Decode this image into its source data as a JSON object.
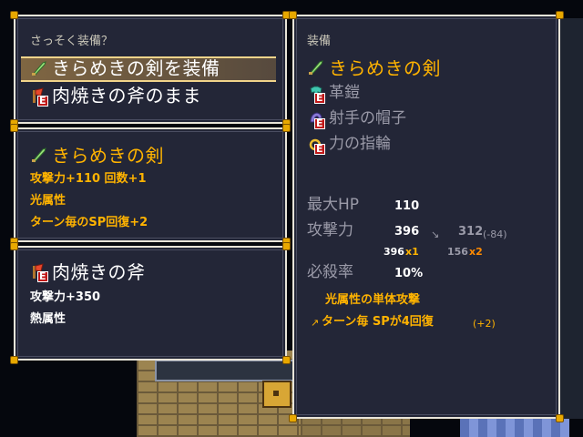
{
  "equip_menu": {
    "prompt": "さっそく装備？",
    "options": [
      {
        "label": "きらめきの剣を装備",
        "selected": true
      },
      {
        "label": "肉焼きの斧のまま",
        "selected": false
      }
    ]
  },
  "new_item": {
    "name": "きらめきの剣",
    "line1": "攻撃力+110 回数+1",
    "line2": "光属性",
    "line3": "ターン毎のSP回復+2"
  },
  "current_item": {
    "name": "肉焼きの斧",
    "line1": "攻撃力+350",
    "line2": "熱属性"
  },
  "status": {
    "header": "装備",
    "equipment": [
      {
        "name": "きらめきの剣",
        "icon": "sword-icon",
        "changed": true
      },
      {
        "name": "革鎧",
        "icon": "armor-icon",
        "changed": false
      },
      {
        "name": "射手の帽子",
        "icon": "hat-icon",
        "changed": false
      },
      {
        "name": "力の指輪",
        "icon": "ring-icon",
        "changed": false
      }
    ],
    "max_hp_label": "最大HP",
    "max_hp_value": "110",
    "attack_label": "攻撃力",
    "attack_old": "396",
    "attack_arrow": "↘",
    "attack_new": "312",
    "attack_diff": "(-84)",
    "attack_old_detail_value": "396",
    "attack_old_detail_mult": "x1",
    "attack_new_detail_value": "156",
    "attack_new_detail_mult": "x2",
    "crit_label": "必殺率",
    "crit_value": "10%",
    "effect1": "光属性の単体攻撃",
    "effect2_arrow": "↗",
    "effect2": "ターン毎 SPが4回復",
    "effect2_diff": "(+2)"
  },
  "colors": {
    "panel": "#232637",
    "border": "#e8e4d8",
    "corner": "#e8a800",
    "highlight": "#ffb300"
  }
}
